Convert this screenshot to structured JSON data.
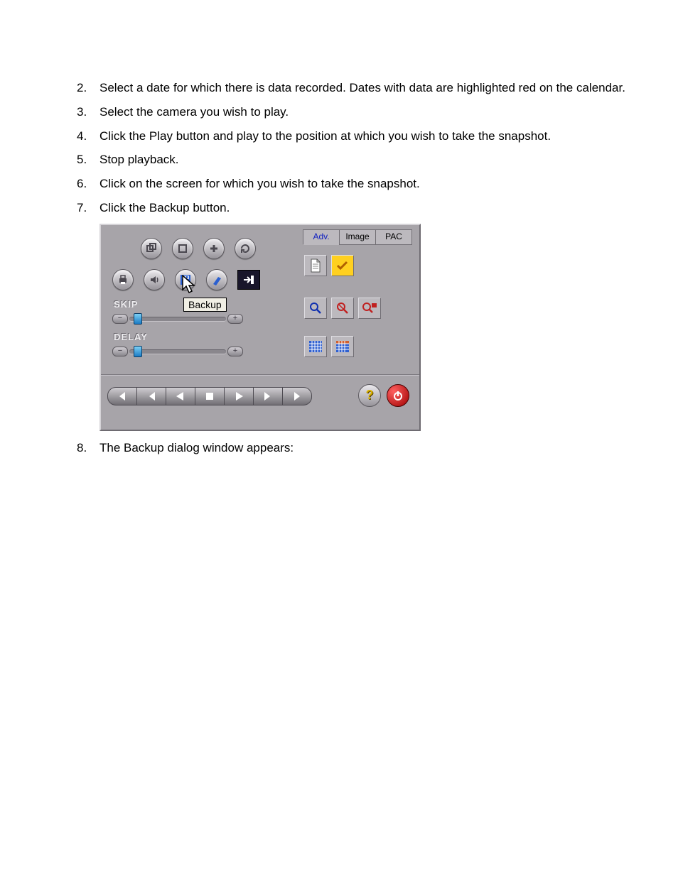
{
  "steps": [
    {
      "n": "2.",
      "t": "Select a date for which there is data recorded. Dates with data are highlighted red on the calendar."
    },
    {
      "n": "3.",
      "t": "Select the camera you wish to play."
    },
    {
      "n": "4.",
      "t": "Click the Play button and play to the position at which you wish to take the snapshot."
    },
    {
      "n": "5.",
      "t": "Stop playback."
    },
    {
      "n": "6.",
      "t": "Click on the screen for which you wish to take the snapshot."
    },
    {
      "n": "7.",
      "t": "Click the Backup button."
    }
  ],
  "step8": {
    "n": "8.",
    "t": "The Backup dialog window appears:"
  },
  "panel": {
    "tooltip": "Backup",
    "skip_label": "SKIP",
    "delay_label": "DELAY",
    "tabs": [
      "Adv.",
      "Image",
      "PAC"
    ],
    "slider_minus": "−",
    "slider_plus": "+",
    "help_glyph": "?",
    "power_glyph": "⏻"
  }
}
